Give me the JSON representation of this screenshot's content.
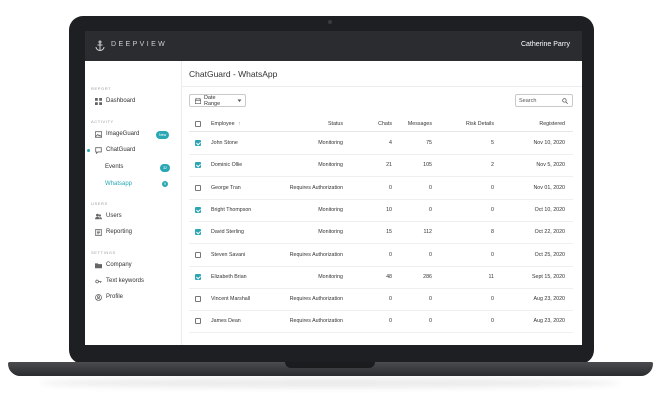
{
  "app": {
    "brand": "DEEPVIEW",
    "user": "Catherine Parry"
  },
  "sidebar": {
    "sections": {
      "report": "REPORT",
      "activity": "ACTIVITY",
      "users": "USERS",
      "settings": "SETTINGS"
    },
    "items": {
      "dashboard": "Dashboard",
      "imageguard": "ImageGuard",
      "imageguard_badge": "New",
      "chatguard": "ChatGuard",
      "events": "Events",
      "events_badge": "32",
      "whatsapp": "Whatsapp",
      "whatsapp_badge": "9",
      "users": "Users",
      "reporting": "Reporting",
      "company": "Company",
      "text_keywords": "Text keywords",
      "profile": "Profile"
    }
  },
  "main": {
    "title": "ChatGuard - WhatsApp",
    "date_range": "Date Range",
    "search_placeholder": "Search",
    "columns": {
      "employee": "Employee",
      "sort_indicator": "↑",
      "status": "Status",
      "chats": "Chats",
      "messages": "Messages",
      "risk": "Risk Details",
      "registered": "Registered"
    },
    "rows": [
      {
        "checked": true,
        "employee": "John Stone",
        "status": "Monitoring",
        "chats": "4",
        "messages": "75",
        "risk": "5",
        "registered": "Nov 10, 2020"
      },
      {
        "checked": true,
        "employee": "Dominic Ollie",
        "status": "Monitoring",
        "chats": "21",
        "messages": "105",
        "risk": "2",
        "registered": "Nov 5, 2020"
      },
      {
        "checked": false,
        "employee": "George Tran",
        "status": "Requires Authorization",
        "chats": "0",
        "messages": "0",
        "risk": "0",
        "registered": "Nov 01, 2020"
      },
      {
        "checked": true,
        "employee": "Bright Thompson",
        "status": "Monitoring",
        "chats": "10",
        "messages": "0",
        "risk": "0",
        "registered": "Oct 10, 2020"
      },
      {
        "checked": true,
        "employee": "David Sterling",
        "status": "Monitoring",
        "chats": "15",
        "messages": "112",
        "risk": "8",
        "registered": "Oct 22, 2020"
      },
      {
        "checked": false,
        "employee": "Steven Savani",
        "status": "Requires Authorization",
        "chats": "0",
        "messages": "0",
        "risk": "0",
        "registered": "Oct 25, 2020"
      },
      {
        "checked": true,
        "employee": "Elizabeth Brian",
        "status": "Monitoring",
        "chats": "48",
        "messages": "286",
        "risk": "11",
        "registered": "Sept 15, 2020"
      },
      {
        "checked": false,
        "employee": "Vincent Marshall",
        "status": "Requires Authorization",
        "chats": "0",
        "messages": "0",
        "risk": "0",
        "registered": "Aug 23, 2020"
      },
      {
        "checked": false,
        "employee": "James Dean",
        "status": "Requires Authorization",
        "chats": "0",
        "messages": "0",
        "risk": "0",
        "registered": "Aug 23, 2020"
      }
    ]
  },
  "colors": {
    "accent": "#2aa7b4",
    "topbar": "#2b2c30"
  }
}
